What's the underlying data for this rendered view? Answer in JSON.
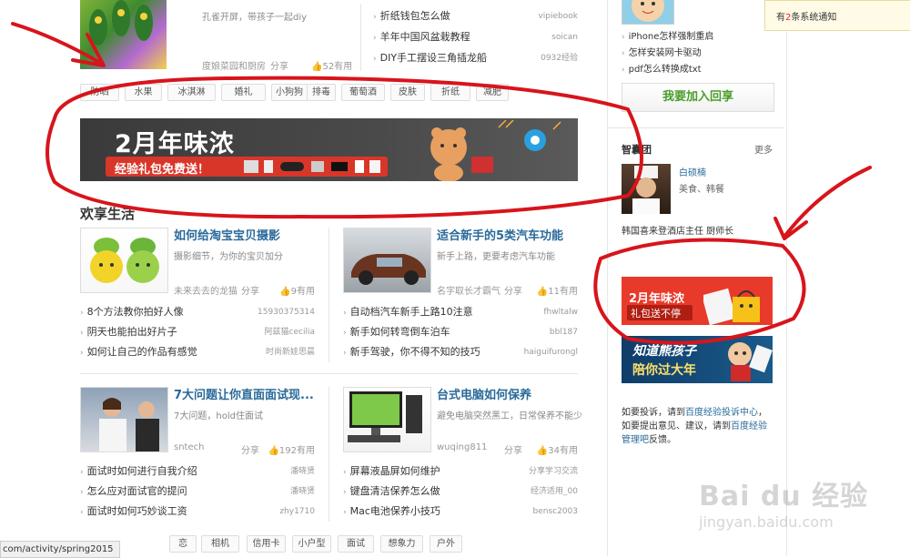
{
  "top": {
    "card1": {
      "title": "孔雀开屏，带孩子一起diy",
      "author": "度娘菜园和厨房",
      "share": "分享",
      "useful": "52有用"
    },
    "list1": [
      {
        "title": "折纸钱包怎么做",
        "src": "vipiebook"
      },
      {
        "title": "羊年中国风盆栽教程",
        "src": "soican"
      },
      {
        "title": "DIY手工摆设三角插龙船",
        "src": "0932经验"
      }
    ],
    "tags": [
      "防晒",
      "水果",
      "冰淇淋",
      "婚礼",
      "小狗狗",
      "排毒",
      "葡萄酒",
      "皮肤",
      "折纸",
      "减肥"
    ]
  },
  "main_banner": {
    "headline": "2月年味浓",
    "sub": "经验礼包免费送！"
  },
  "section_title": "欢享生活",
  "cards": [
    {
      "title": "如何给淘宝宝贝摄影",
      "desc": "摄影细节，为你的宝贝加分",
      "author": "未来去去的龙猫",
      "share": "分享",
      "useful": "9有用",
      "list": [
        {
          "title": "8个方法教你拍好人像",
          "src": "15930375314"
        },
        {
          "title": "阴天也能拍出好片子",
          "src": "阿兹猫cecilia"
        },
        {
          "title": "如何让自己的作品有感觉",
          "src": "时尚新娃思晨"
        }
      ]
    },
    {
      "title": "适合新手的5类汽车功能",
      "desc": "新手上路，更要考虑汽车功能",
      "author": "名字取长才霸气",
      "share": "分享",
      "useful": "11有用",
      "list": [
        {
          "title": "自动档汽车新手上路10注意",
          "src": "fhwltalw"
        },
        {
          "title": "新手如何转弯倒车泊车",
          "src": "bbl187"
        },
        {
          "title": "新手驾驶，你不得不知的技巧",
          "src": "haiguifurongl"
        }
      ]
    },
    {
      "title": "7大问题让你直面面试现...",
      "desc": "7大问题，hold住面试",
      "author": "sntech",
      "share": "分享",
      "useful": "192有用",
      "list": [
        {
          "title": "面试时如何进行自我介绍",
          "src": "潘晓贤"
        },
        {
          "title": "怎么应对面试官的提问",
          "src": "潘晓贤"
        },
        {
          "title": "面试时如何巧妙谈工资",
          "src": "zhy1710"
        }
      ]
    },
    {
      "title": "台式电脑如何保养",
      "desc": "避免电脑突然黑工，日常保养不能少",
      "author": "wuqing811",
      "share": "分享",
      "useful": "34有用",
      "list": [
        {
          "title": "屏幕液晶屏如何维护",
          "src": "分享学习交流"
        },
        {
          "title": "键盘清洁保养怎么做",
          "src": "经济适用_00"
        },
        {
          "title": "Mac电池保养小技巧",
          "src": "bensc2003"
        }
      ]
    }
  ],
  "bottom_tags": [
    "相机",
    "信用卡",
    "小户型",
    "面试",
    "想象力",
    "户外"
  ],
  "bottom_tag_partial": "恋",
  "status_url": "com/activity/spring2015",
  "sidebar": {
    "notice": {
      "prefix": "有",
      "count": "2",
      "suffix": "条系统通知"
    },
    "links": [
      "iPhone怎样强制重启",
      "怎样安装网卡驱动",
      "pdf怎么转换成txt"
    ],
    "join_button": "我要加入回享",
    "think_title": "智囊团",
    "more": "更多",
    "person": {
      "name": "白硕楠",
      "tags": "美食、韩餐",
      "bio": "韩国喜来登酒店主任 厨师长"
    },
    "ad1": {
      "line1": "2月年味浓",
      "line2": "礼包送不停"
    },
    "ad2": {
      "line1": "知道熊孩子",
      "line2": "陪你过大年"
    },
    "footer": {
      "p1": "如要投诉，请到",
      "l1": "百度经验投诉中心",
      "p2": "，如要提出意见、建议，请到",
      "l2": "百度经验管理吧",
      "p3": "反馈。"
    }
  },
  "watermark": {
    "logo": "Bai du 经验",
    "url": "jingyan.baidu.com"
  }
}
